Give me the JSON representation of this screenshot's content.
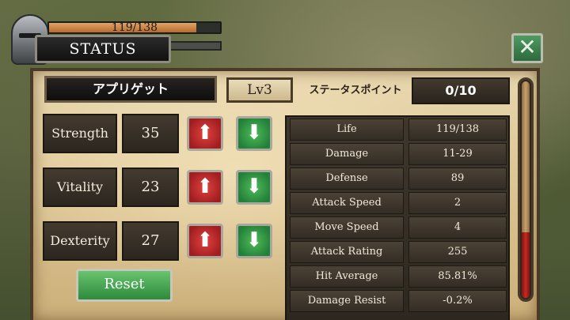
{
  "hud": {
    "hp_text": "119/138",
    "hp_fraction": 0.862,
    "status_title": "STATUS",
    "close_symbol": "✕"
  },
  "header": {
    "character_name": "アプリゲット",
    "level": "Lv3",
    "status_points_label": "ステータスポイント",
    "status_points_value": "0/10"
  },
  "stats": [
    {
      "name": "Strength",
      "value": "35"
    },
    {
      "name": "Vitality",
      "value": "23"
    },
    {
      "name": "Dexterity",
      "value": "27"
    }
  ],
  "buttons": {
    "up_symbol": "⬆",
    "down_symbol": "⬇",
    "reset_label": "Reset"
  },
  "table": [
    {
      "label": "Life",
      "value": "119/138"
    },
    {
      "label": "Damage",
      "value": "11-29"
    },
    {
      "label": "Defense",
      "value": "89"
    },
    {
      "label": "Attack Speed",
      "value": "2"
    },
    {
      "label": "Move Speed",
      "value": "4"
    },
    {
      "label": "Attack Rating",
      "value": "255"
    },
    {
      "label": "Hit Average",
      "value": "85.81%"
    },
    {
      "label": "Damage Resist",
      "value": "-0.2%"
    }
  ],
  "experience_gauge_fraction": 0.3,
  "icons": [
    "helmet-icon",
    "close-icon",
    "arrow-up-icon",
    "arrow-down-icon"
  ],
  "colors": {
    "increase_button": "#c92e2c",
    "decrease_button": "#2f9a43",
    "reset_button": "#3f9c47",
    "panel_background": "#dcc595"
  }
}
